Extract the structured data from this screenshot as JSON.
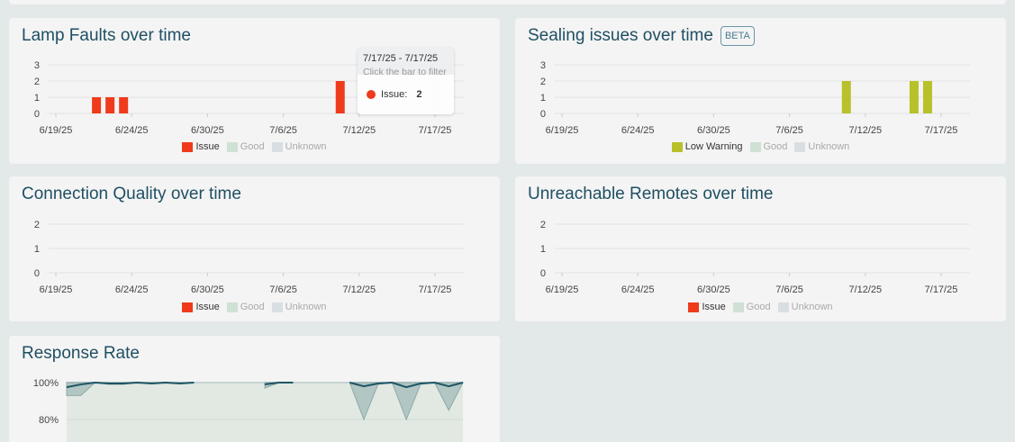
{
  "colors": {
    "issue": "#ef3b1c",
    "good": "#cfe1d4",
    "unknown": "#d8dfe3",
    "low_warning": "#b8c12a",
    "grid": "#e2e2e2",
    "line": "#1e5565",
    "band": "#a9bfbd",
    "plot_bg": "#e1e9e2"
  },
  "dates": [
    "6/19/25",
    "6/20/25",
    "6/21/25",
    "6/22/25",
    "6/23/25",
    "6/24/25",
    "6/25/25",
    "6/26/25",
    "6/27/25",
    "6/28/25",
    "6/29/25",
    "6/30/25",
    "7/1/25",
    "7/2/25",
    "7/3/25",
    "7/4/25",
    "7/5/25",
    "7/6/25",
    "7/7/25",
    "7/8/25",
    "7/9/25",
    "7/10/25",
    "7/11/25",
    "7/12/25",
    "7/13/25",
    "7/14/25",
    "7/15/25",
    "7/16/25",
    "7/17/25"
  ],
  "x_ticks": [
    "6/19/25",
    "6/24/25",
    "6/30/25",
    "7/6/25",
    "7/12/25",
    "7/17/25"
  ],
  "charts": {
    "lamp": {
      "title": "Lamp Faults over time",
      "ylim": [
        0,
        3
      ],
      "yticks": [
        "0",
        "1",
        "2",
        "3"
      ],
      "legend": [
        {
          "label": "Issue",
          "color": "#ef3b1c",
          "active": true
        },
        {
          "label": "Good",
          "color": "#cfe1d4",
          "active": false
        },
        {
          "label": "Unknown",
          "color": "#d8dfe3",
          "active": false
        }
      ],
      "bars": [
        {
          "date": "6/22/25",
          "value": 1
        },
        {
          "date": "6/23/25",
          "value": 1
        },
        {
          "date": "6/24/25",
          "value": 1
        },
        {
          "date": "7/10/25",
          "value": 2
        },
        {
          "date": "7/17/25",
          "value": 2
        }
      ],
      "tooltip": {
        "range": "7/17/25 - 7/17/25",
        "hint": "Click the bar to filter",
        "series": "Issue:",
        "value": "2"
      }
    },
    "sealing": {
      "title": "Sealing issues over time",
      "badge": "BETA",
      "ylim": [
        0,
        3
      ],
      "yticks": [
        "0",
        "1",
        "2",
        "3"
      ],
      "legend": [
        {
          "label": "Low Warning",
          "color": "#b8c12a",
          "active": true
        },
        {
          "label": "Good",
          "color": "#cfe1d4",
          "active": false
        },
        {
          "label": "Unknown",
          "color": "#d8dfe3",
          "active": false
        }
      ],
      "bars": [
        {
          "date": "7/10/25",
          "value": 2
        },
        {
          "date": "7/15/25",
          "value": 2
        },
        {
          "date": "7/16/25",
          "value": 2
        }
      ]
    },
    "connection": {
      "title": "Connection Quality over time",
      "ylim": [
        0,
        2
      ],
      "yticks": [
        "0",
        "1",
        "2"
      ],
      "legend": [
        {
          "label": "Issue",
          "color": "#ef3b1c",
          "active": true
        },
        {
          "label": "Good",
          "color": "#cfe1d4",
          "active": false
        },
        {
          "label": "Unknown",
          "color": "#d8dfe3",
          "active": false
        }
      ],
      "bars": []
    },
    "unreachable": {
      "title": "Unreachable Remotes over time",
      "ylim": [
        0,
        2
      ],
      "yticks": [
        "0",
        "1",
        "2"
      ],
      "legend": [
        {
          "label": "Issue",
          "color": "#ef3b1c",
          "active": true
        },
        {
          "label": "Good",
          "color": "#cfe1d4",
          "active": false
        },
        {
          "label": "Unknown",
          "color": "#d8dfe3",
          "active": false
        }
      ],
      "bars": []
    },
    "response": {
      "title": "Response Rate",
      "yticks": [
        "100%",
        "80%"
      ],
      "line": [
        97.5,
        99,
        100,
        99.5,
        99.5,
        100,
        99.5,
        100,
        99.5,
        100,
        null,
        null,
        null,
        null,
        99,
        100,
        100,
        null,
        null,
        null,
        100,
        98,
        99.5,
        100,
        97.5,
        99.5,
        100,
        98,
        100
      ],
      "lower": [
        93,
        93,
        100,
        99,
        99,
        100,
        99.5,
        100,
        99.5,
        100,
        null,
        null,
        null,
        null,
        97,
        100,
        100,
        null,
        null,
        null,
        100,
        80,
        99,
        100,
        80,
        99,
        100,
        85,
        100
      ]
    }
  }
}
